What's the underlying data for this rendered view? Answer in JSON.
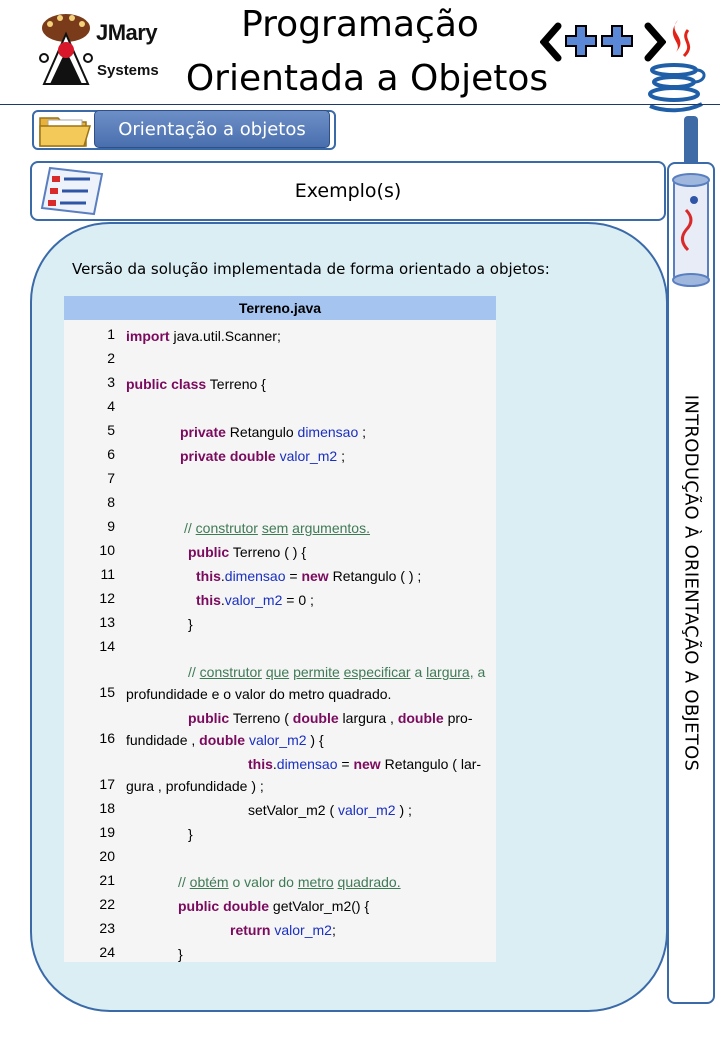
{
  "header": {
    "logo_line1": "JMary",
    "logo_line2": "Systems",
    "title_line1": "Programação",
    "title_line2": "Orientada a Objetos"
  },
  "topic": {
    "label": "Orientação a objetos"
  },
  "section": {
    "label": "Exemplo(s)"
  },
  "sidebar": {
    "label": "INTRODUÇÃO À ORIENTAÇÃO A OBJETOS"
  },
  "content": {
    "intro": "Versão da solução implementada de forma orientado a objetos:",
    "code_title": "Terreno.java",
    "lines": [
      {
        "n": "1",
        "text": "import java.util.Scanner;"
      },
      {
        "n": "2",
        "text": ""
      },
      {
        "n": "3",
        "text": "public class Terreno {"
      },
      {
        "n": "4",
        "text": ""
      },
      {
        "n": "5",
        "text": "private Retangulo dimensao ;"
      },
      {
        "n": "6",
        "text": "private double valor_m2 ;"
      },
      {
        "n": "7",
        "text": ""
      },
      {
        "n": "8",
        "text": ""
      },
      {
        "n": "9",
        "text": "// construtor sem argumentos."
      },
      {
        "n": "10",
        "text": "public Terreno ( ) {"
      },
      {
        "n": "11",
        "text": "this.dimensao = new Retangulo ( ) ;"
      },
      {
        "n": "12",
        "text": "this.valor_m2 = 0 ;"
      },
      {
        "n": "13",
        "text": "}"
      },
      {
        "n": "14",
        "text": ""
      },
      {
        "n": "15",
        "text": "// construtor que permite especificar a largura, a profundidade e o valor do metro quadrado."
      },
      {
        "n": "16",
        "text": "public Terreno ( double largura , double profundidade , double valor_m2 ) {"
      },
      {
        "n": "17",
        "text": "this.dimensao = new Retangulo ( largura , profundidade ) ;"
      },
      {
        "n": "18",
        "text": "setValor_m2 ( valor_m2 ) ;"
      },
      {
        "n": "19",
        "text": "}"
      },
      {
        "n": "20",
        "text": ""
      },
      {
        "n": "21",
        "text": "// obtém o valor do metro quadrado."
      },
      {
        "n": "22",
        "text": "public double getValor_m2() {"
      },
      {
        "n": "23",
        "text": "return valor_m2;"
      },
      {
        "n": "24",
        "text": "}"
      }
    ]
  },
  "colors": {
    "accent": "#3a6aa8",
    "panel_bg": "#dbeef4",
    "code_header_bg": "#a5c4ef",
    "keyword": "#7b0a5e",
    "field": "#1a2fc0",
    "comment": "#3f7a55"
  },
  "icons": [
    "duke-mascot-logo",
    "cpp-logo",
    "java-logo",
    "folder-icon",
    "checklist-icon",
    "scroll-icon"
  ]
}
